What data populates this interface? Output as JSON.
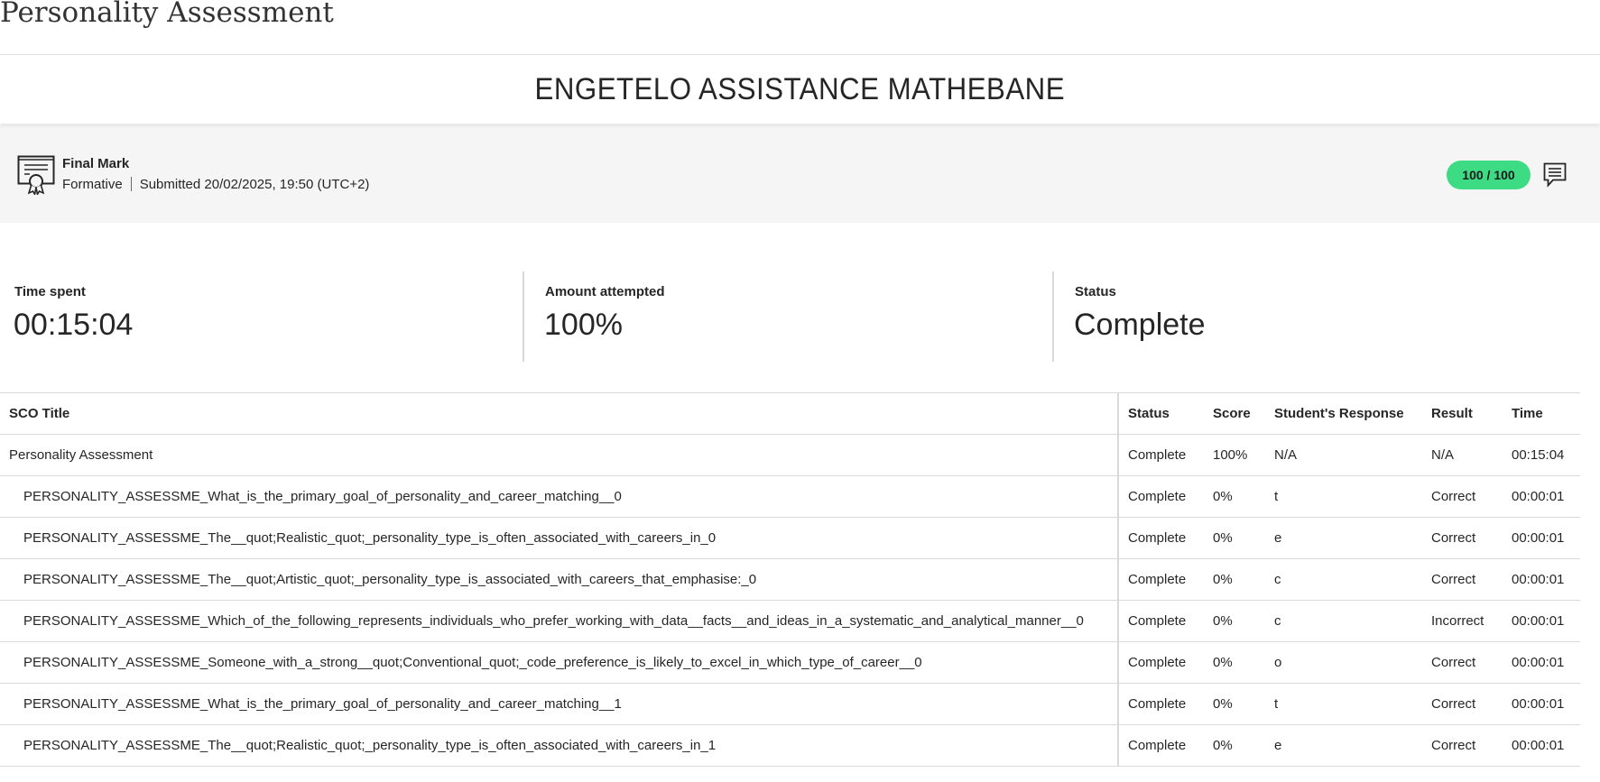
{
  "page": {
    "title": "Personality Assessment"
  },
  "student": {
    "name": "ENGETELO ASSISTANCE MATHEBANE"
  },
  "final_mark": {
    "icon": "certificate-icon",
    "title": "Final Mark",
    "type": "Formative",
    "submitted": "Submitted 20/02/2025, 19:50 (UTC+2)",
    "score": "100 / 100",
    "score_color": "#3ddc84",
    "feedback_icon": "comment-icon"
  },
  "stats": [
    {
      "label": "Time spent",
      "value": "00:15:04"
    },
    {
      "label": "Amount attempted",
      "value": "100%"
    },
    {
      "label": "Status",
      "value": "Complete"
    }
  ],
  "table": {
    "headers": [
      "SCO Title",
      "Status",
      "Score",
      "Student's Response",
      "Result",
      "Time"
    ],
    "rows": [
      {
        "title": "Personality Assessment",
        "status": "Complete",
        "score": "100%",
        "response": "N/A",
        "result": "N/A",
        "time": "00:15:04"
      },
      {
        "title": "PERSONALITY_ASSESSME_What_is_the_primary_goal_of_personality_and_career_matching__0",
        "status": "Complete",
        "score": "0%",
        "response": "t",
        "result": "Correct",
        "time": "00:00:01"
      },
      {
        "title": "PERSONALITY_ASSESSME_The__quot;Realistic_quot;_personality_type_is_often_associated_with_careers_in_0",
        "status": "Complete",
        "score": "0%",
        "response": "e",
        "result": "Correct",
        "time": "00:00:01"
      },
      {
        "title": "PERSONALITY_ASSESSME_The__quot;Artistic_quot;_personality_type_is_associated_with_careers_that_emphasise:_0",
        "status": "Complete",
        "score": "0%",
        "response": "c",
        "result": "Correct",
        "time": "00:00:01"
      },
      {
        "title": "PERSONALITY_ASSESSME_Which_of_the_following_represents_individuals_who_prefer_working_with_data__facts__and_ideas_in_a_systematic_and_analytical_manner__0",
        "status": "Complete",
        "score": "0%",
        "response": "c",
        "result": "Incorrect",
        "time": "00:00:01"
      },
      {
        "title": "PERSONALITY_ASSESSME_Someone_with_a_strong__quot;Conventional_quot;_code_preference_is_likely_to_excel_in_which_type_of_career__0",
        "status": "Complete",
        "score": "0%",
        "response": "o",
        "result": "Correct",
        "time": "00:00:01"
      },
      {
        "title": "PERSONALITY_ASSESSME_What_is_the_primary_goal_of_personality_and_career_matching__1",
        "status": "Complete",
        "score": "0%",
        "response": "t",
        "result": "Correct",
        "time": "00:00:01"
      },
      {
        "title": "PERSONALITY_ASSESSME_The__quot;Realistic_quot;_personality_type_is_often_associated_with_careers_in_1",
        "status": "Complete",
        "score": "0%",
        "response": "e",
        "result": "Correct",
        "time": "00:00:01"
      }
    ]
  }
}
